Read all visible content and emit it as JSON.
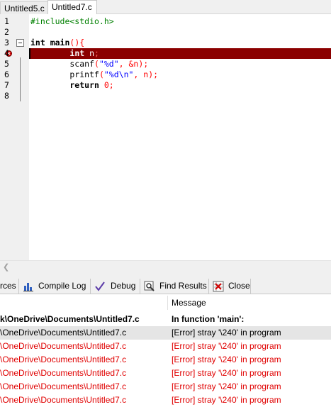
{
  "editor_tabs": [
    {
      "label": "Untitled5.c",
      "active": false
    },
    {
      "label": "Untitled7.c",
      "active": true
    }
  ],
  "code_lines": [
    {
      "num": "1"
    },
    {
      "num": "2"
    },
    {
      "num": "3"
    },
    {
      "num": "4"
    },
    {
      "num": "5"
    },
    {
      "num": "6"
    },
    {
      "num": "7"
    },
    {
      "num": "8"
    }
  ],
  "code": {
    "l1": "#include<stdio.h>",
    "l3_kw": "int",
    "l3_name": " main",
    "l3_sym": "(){",
    "l4_indent": "        ",
    "l4_kw": "int",
    "l4_rest": " n",
    "l4_semi": ";",
    "l5_fn": "        scanf",
    "l5_open": "(",
    "l5_str": "\"%d\"",
    "l5_rest": ", &n);",
    "l6_fn": "        printf",
    "l6_open": "(",
    "l6_str": "\"%d\\n\"",
    "l6_rest": ", n);",
    "l7_kw": "        return",
    "l7_num": " 0",
    "l7_semi": ";"
  },
  "panel_tabs": [
    {
      "label": "rces",
      "icon": "resources-icon"
    },
    {
      "label": "Compile Log",
      "icon": "bar-chart-icon"
    },
    {
      "label": "Debug",
      "icon": "check-debug-icon"
    },
    {
      "label": "Find Results",
      "icon": "find-icon"
    },
    {
      "label": "Close",
      "icon": "close-grid-icon"
    }
  ],
  "messages": {
    "header": "Message",
    "rows": [
      {
        "file": "k\\OneDrive\\Documents\\Untitled7.c",
        "message": "In function 'main':",
        "style": "bold"
      },
      {
        "file": "\\OneDrive\\Documents\\Untitled7.c",
        "message": "[Error] stray '\\240' in program",
        "style": "selected"
      },
      {
        "file": "\\OneDrive\\Documents\\Untitled7.c",
        "message": "[Error] stray '\\240' in program",
        "style": "error"
      },
      {
        "file": "\\OneDrive\\Documents\\Untitled7.c",
        "message": "[Error] stray '\\240' in program",
        "style": "error"
      },
      {
        "file": "\\OneDrive\\Documents\\Untitled7.c",
        "message": "[Error] stray '\\240' in program",
        "style": "error"
      },
      {
        "file": "\\OneDrive\\Documents\\Untitled7.c",
        "message": "[Error] stray '\\240' in program",
        "style": "error"
      },
      {
        "file": "\\OneDrive\\Documents\\Untitled7.c",
        "message": "[Error] stray '\\240' in program",
        "style": "error"
      }
    ]
  },
  "colors": {
    "error_line_bg": "#8b0000",
    "error_text": "#e00000",
    "string": "#0000ff",
    "preprocessor": "#008000"
  }
}
